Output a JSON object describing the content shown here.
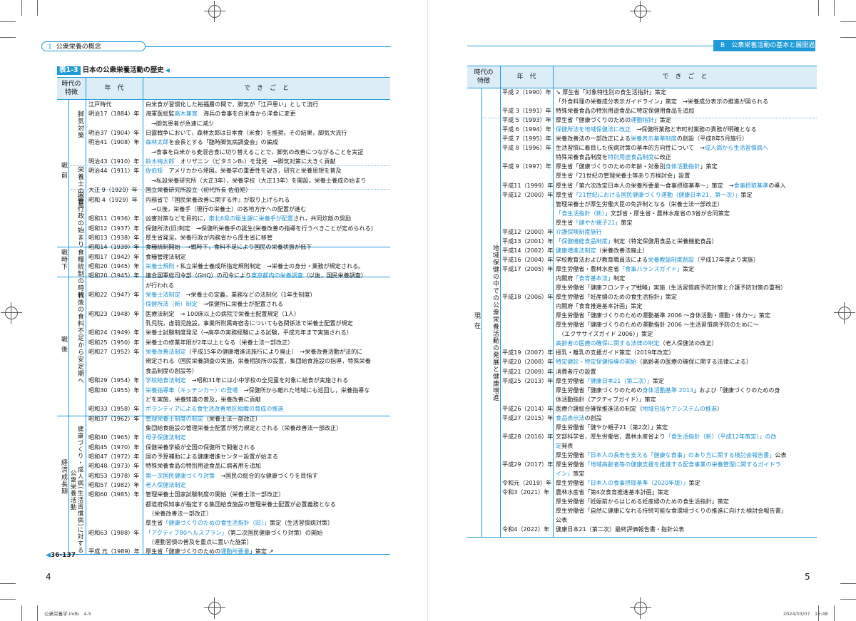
{
  "left_page": {
    "running_head": {
      "number": "1",
      "label": "公衆栄養の概念"
    },
    "table_title": {
      "label": "表1-3",
      "text": "日本の公衆栄養活動の歴史",
      "marker": "◀"
    },
    "columns": {
      "feature_l1": "時代の",
      "feature_l2": "特徴",
      "year": "年　代",
      "event": "で　き　ご　と"
    },
    "eras": {
      "prewar": "戦 前",
      "prewar_a": "脚気対策",
      "prewar_b": "栄養士の誕生",
      "prewar_c": "栄養行政の始まり",
      "wartime": "戦時下",
      "wartime_sub": "食糧統制の時代",
      "postwar": "戦 後",
      "postwar_sub": "戦後の食料不足から安定期へ",
      "growth": "経済成長期",
      "growth_sub": "健康づくり・成人病(生活習慣病)に対する公衆栄養活動"
    },
    "rows": [
      {
        "year": "江戸時代",
        "event": [
          {
            "t": "白米食が習慣化した裕福層の間で，脚気が「江戸患い」として流行"
          }
        ]
      },
      {
        "year": "明治17（1884）年",
        "event": [
          {
            "t": "海軍医総監"
          },
          {
            "t": "高木兼寛",
            "h": true
          },
          {
            "t": "　海兵の食事を白米食から洋食に変更"
          }
        ]
      },
      {
        "year": "",
        "event": [
          {
            "t": "　→脚気患者が急速に減少"
          }
        ]
      },
      {
        "year": "明治37（1904）年",
        "event": [
          {
            "t": "日露戦争において，森林太郎は日本食（米食）を推奨。その結果，脚気大流行"
          }
        ]
      },
      {
        "year": "明治41（1908）年",
        "event": [
          {
            "t": "森林太郎",
            "h": true
          },
          {
            "t": "を会長とする「臨時脚気病調査会」の編成"
          }
        ]
      },
      {
        "year": "",
        "event": [
          {
            "t": "　→食事を白米から麦混合食に切り替えることで，脚気の改善につながることを実証"
          }
        ]
      },
      {
        "year": "明治43（1910）年",
        "event": [
          {
            "t": "鈴木梅太郎",
            "h": true
          },
          {
            "t": "　オリザニン（ビタミンB₁）を発見　→脚気対策に大きく貢献"
          }
        ]
      },
      {
        "year": "明治44（1911）年",
        "event": [
          {
            "t": "佐伯矩",
            "h": true
          },
          {
            "t": "　アメリカから帰国。栄養学の重要性を説き，研究と栄養思想を普及"
          }
        ]
      },
      {
        "year": "",
        "event": [
          {
            "t": "　→私設栄養研究所（大正3年），栄養学校（大正13年）を開設。栄養士養成の始まり"
          }
        ]
      },
      {
        "year": "大正 9（1920）年",
        "event": [
          {
            "t": "国立栄養研究所設立（初代所長 佐伯矩）"
          }
        ]
      },
      {
        "year": "昭和 4（1929）年",
        "event": [
          {
            "t": "内務省で『国民栄養改善に関する件』が取り上げられる"
          }
        ]
      },
      {
        "year": "",
        "event": [
          {
            "t": "　→以後，栄養手（現行の栄養士）の各地方庁への配置が進む"
          }
        ]
      },
      {
        "year": "昭和11（1936）年",
        "event": [
          {
            "t": "凶害対策などを目的に，"
          },
          {
            "t": "東北6県の衛生課に栄養手が配置",
            "h": true
          },
          {
            "t": "され，共同炊飯の奨励"
          }
        ]
      },
      {
        "year": "昭和12（1937）年",
        "event": [
          {
            "t": "保健所法(旧)制定　→保健所栄養手の誕生(栄養改善の指導を行うべきことが定められる)"
          }
        ]
      },
      {
        "year": "昭和13（1938）年",
        "event": [
          {
            "t": "厚生省発足。栄養行政が内務省から厚生省に移管"
          }
        ]
      },
      {
        "year": "昭和14（1939）年",
        "event": [
          {
            "t": "食糧統制開始　→戦時下，食料不足により国民の栄養状態が低下"
          }
        ]
      },
      {
        "year": "昭和17（1942）年",
        "event": [
          {
            "t": "食糧管理法制定"
          }
        ]
      },
      {
        "year": "昭和20（1945）年",
        "event": [
          {
            "t": "栄養士規則",
            "h": true
          },
          {
            "t": "・私立栄養士養成所指定規則制定　→栄養士の身分・業務が規定される。"
          }
        ]
      },
      {
        "year": "昭和20（1945）年",
        "event": [
          {
            "t": "連合国軍総司令部（GHQ）の司令により"
          },
          {
            "t": "東京都内の栄養調査",
            "h": true
          },
          {
            "t": "（以後，国民栄養調査）"
          }
        ]
      },
      {
        "year": "",
        "event": [
          {
            "t": "が行われる"
          }
        ]
      },
      {
        "year": "昭和22（1947）年",
        "event": [
          {
            "t": "栄養士法制定",
            "h": true
          },
          {
            "t": "　→栄養士の定義，業務などの法制化（1年生制度）"
          }
        ]
      },
      {
        "year": "",
        "event": [
          {
            "t": "保健所法（新）制定",
            "h": true
          },
          {
            "t": "　→保健所に栄養士が配置される"
          }
        ]
      },
      {
        "year": "昭和23（1948）年",
        "event": [
          {
            "t": "医療法制定　→ 100床以上の病院で栄養士配置規定（1人）"
          }
        ]
      },
      {
        "year": "",
        "event": [
          {
            "t": "乳児院，虚弱児施設，事業所附属寄宿舎についても各関係法で栄養士配置が規定"
          }
        ]
      },
      {
        "year": "昭和24（1949）年",
        "event": [
          {
            "t": "栄養士試験制度発足（→高卒の実務経験による試験，平成元年まで実施される）"
          }
        ]
      },
      {
        "year": "昭和25（1950）年",
        "event": [
          {
            "t": "栄養士の修業年限が2年以上となる（栄養士法一部改正）"
          }
        ]
      },
      {
        "year": "昭和27（1952）年",
        "event": [
          {
            "t": "栄養改善法制定",
            "h": true
          },
          {
            "t": "（平成15年の健康増進法施行により廃止）　→栄養改善活動が法的に"
          }
        ]
      },
      {
        "year": "",
        "event": [
          {
            "t": "規定される（国民栄養調査の実施，栄養相談所の設置，集団給食施設の指導，特殊栄養"
          }
        ]
      },
      {
        "year": "",
        "event": [
          {
            "t": "食品制度の創設等）"
          }
        ]
      },
      {
        "year": "昭和29（1954）年",
        "event": [
          {
            "t": "学校給食法制定",
            "h": true
          },
          {
            "t": "　→昭和31年には小中学校の全児童を対象に給食が実施される"
          }
        ]
      },
      {
        "year": "昭和30（1955）年",
        "event": [
          {
            "t": "栄養指導車（キッチンカー）の登場",
            "h": true
          },
          {
            "t": "　→保健所から離れた地域にも巡回し，栄養指導な"
          }
        ]
      },
      {
        "year": "",
        "event": [
          {
            "t": "どを実施，栄養知識の普及，栄養改善に貢献"
          }
        ]
      },
      {
        "year": "昭和33（1958）年",
        "event": [
          {
            "t": "ボランティアによる食生活改善地区組織の育成の推進",
            "h": true
          }
        ]
      },
      {
        "year": "昭和37（1962）年",
        "event": [
          {
            "t": "管理栄養士制度の制定",
            "h": true
          },
          {
            "t": "（栄養士法一部改正）"
          }
        ]
      },
      {
        "year": "",
        "event": [
          {
            "t": "集団給食施設の管理栄養士配置が努力規定とされる（栄養改善法一部改正）"
          }
        ]
      },
      {
        "year": "昭和40（1965）年",
        "event": [
          {
            "t": "母子保健法制定",
            "h": true
          }
        ]
      },
      {
        "year": "昭和45（1970）年",
        "event": [
          {
            "t": "保健栄養学級が全国の保健所で開催される"
          }
        ]
      },
      {
        "year": "昭和47（1972）年",
        "event": [
          {
            "t": "国の予算補助による健康増進センター設置が始まる"
          }
        ]
      },
      {
        "year": "昭和48（1973）年",
        "event": [
          {
            "t": "特殊栄養食品の特別用途食品に病者用を追加"
          }
        ]
      },
      {
        "year": "昭和53（1978）年",
        "event": [
          {
            "t": "第一次国民健康づくり対策",
            "h": true
          },
          {
            "t": "　→国民の総合的な健康づくりを目指す"
          }
        ]
      },
      {
        "year": "昭和57（1982）年",
        "event": [
          {
            "t": "老人保健法制定",
            "h": true
          }
        ]
      },
      {
        "year": "昭和60（1985）年",
        "event": [
          {
            "t": "管理栄養士国家試験制度の開始（栄養士法一部改正）"
          }
        ]
      },
      {
        "year": "",
        "event": [
          {
            "t": "都道府県知事が指定する集団給食施設の管理栄養士配置が必置義務となる"
          }
        ]
      },
      {
        "year": "",
        "event": [
          {
            "t": "　（栄養改善法一部改正）"
          }
        ]
      },
      {
        "year": "",
        "event": [
          {
            "t": "厚生省"
          },
          {
            "t": "「健康づくりのための食生活指針（旧）」",
            "h": true
          },
          {
            "t": "策定（生活習慣病対策）"
          }
        ]
      },
      {
        "year": "昭和63（1988）年",
        "event": [
          {
            "t": "「アクティブ80ヘルスプラン」",
            "h": true
          },
          {
            "t": "（第二次国民健康づくり対策）の開始"
          }
        ]
      },
      {
        "year": "",
        "event": [
          {
            "t": "　（運動習慣の普及を重点に置いた施策）"
          }
        ]
      },
      {
        "year": "平成 元（1989）年",
        "event": [
          {
            "t": "厚生省「健康づくりのための"
          },
          {
            "t": "運動所要量",
            "h": true
          },
          {
            "t": "」策定 ↗"
          }
        ]
      }
    ],
    "xref": "36-137",
    "page_number": "4",
    "footer_file": "公衆栄養学.indb　4-5"
  },
  "right_page": {
    "running_head": {
      "letter": "B",
      "label": "公衆栄養活動の基本と展開過程"
    },
    "columns": {
      "feature_l1": "時代の",
      "feature_l2": "特徴",
      "year": "年　代",
      "event": "で　き　ご　と"
    },
    "eras": {
      "present": "現 在",
      "present_sub": "地域保健の中での公衆栄養活動の発展と健康増進"
    },
    "rows": [
      {
        "year": "平成 2（1990）年",
        "event": [
          {
            "t": "↘ 厚生省「対象特性別の食生活指針」策定"
          }
        ]
      },
      {
        "year": "",
        "event": [
          {
            "t": "「外食料理の栄養成分表示ガイドライン」策定　→栄養成分表示の推進が図られる"
          }
        ]
      },
      {
        "year": "平成 3（1991）年",
        "event": [
          {
            "t": "特殊栄養食品の特別用途食品に特定保健用食品を追加"
          }
        ]
      },
      {
        "year": "平成 5（1993）年",
        "event": [
          {
            "t": "厚生省「健康づくりのための"
          },
          {
            "t": "運動指針",
            "h": true
          },
          {
            "t": "」策定"
          }
        ]
      },
      {
        "year": "平成 6（1994）年",
        "event": [
          {
            "t": "保健所法を地域保健法に改正",
            "h": true
          },
          {
            "t": "　→保健所業務と市町村業務の責務が明確となる"
          }
        ]
      },
      {
        "year": "平成 7（1995）年",
        "event": [
          {
            "t": "栄養改善法の一部改正による"
          },
          {
            "t": "栄養表示基準制度",
            "h": true
          },
          {
            "t": "の創設（平成8年5月施行）"
          }
        ]
      },
      {
        "year": "平成 8（1996）年",
        "event": [
          {
            "t": "生活習慣に着目した疾病対策の基本的方向性について　→"
          },
          {
            "t": "成人病から生活習慣病へ",
            "h": true
          }
        ]
      },
      {
        "year": "",
        "event": [
          {
            "t": "特殊栄養食品制度を"
          },
          {
            "t": "特別用途食品制度",
            "h": true
          },
          {
            "t": "に改正"
          }
        ]
      },
      {
        "year": "平成 9（1997）年",
        "event": [
          {
            "t": "厚生省「健康づくりのための年齢・対象別"
          },
          {
            "t": "身体活動指針",
            "h": true
          },
          {
            "t": "」策定"
          }
        ]
      },
      {
        "year": "",
        "event": [
          {
            "t": "厚生省「21世紀の管理栄養士等あり方検討会」設置"
          }
        ]
      },
      {
        "year": "平成11（1999）年",
        "event": [
          {
            "t": "厚生省「第六次改定日本人の栄養所要量〜食事摂取基準〜」策定　→"
          },
          {
            "t": "食事摂取基準",
            "h": true
          },
          {
            "t": "の導入"
          }
        ]
      },
      {
        "year": "平成12（2000）年",
        "event": [
          {
            "t": "厚生省"
          },
          {
            "t": "「21世紀における国民健康づくり運動（健康日本21，第一次）」",
            "h": true
          },
          {
            "t": "策定"
          }
        ]
      },
      {
        "year": "",
        "event": [
          {
            "t": "管理栄養士が厚生労働大臣の免許制となる（栄養士法一部改正）"
          }
        ]
      },
      {
        "year": "",
        "event": [
          {
            "t": "「食生活指針（新）」",
            "h": true
          },
          {
            "t": "文部省・厚生省・農林水産省の3省が合同策定"
          }
        ]
      },
      {
        "year": "",
        "event": [
          {
            "t": "厚生省"
          },
          {
            "t": "「健やか親子21」",
            "h": true
          },
          {
            "t": "策定"
          }
        ]
      },
      {
        "year": "平成12（2000）年",
        "event": [
          {
            "t": "介護保険制度施行",
            "h": true
          }
        ]
      },
      {
        "year": "平成13（2001）年",
        "event": [
          {
            "t": "「保健機能食品制度」",
            "h": true
          },
          {
            "t": "制定（特定保健用食品と栄養機能食品）"
          }
        ]
      },
      {
        "year": "平成14（2002）年",
        "event": [
          {
            "t": "健康増進法制定",
            "h": true
          },
          {
            "t": "（栄養改善法廃止）"
          }
        ]
      },
      {
        "year": "平成16（2004）年",
        "event": [
          {
            "t": "学校教育法および教育職員法による"
          },
          {
            "t": "栄養教諭制度創設",
            "h": true
          },
          {
            "t": "（平成17年度より実施）"
          }
        ]
      },
      {
        "year": "平成17（2005）年",
        "event": [
          {
            "t": "厚生労働省・農林水産省"
          },
          {
            "t": "「食事バランスガイド」",
            "h": true
          },
          {
            "t": "策定"
          }
        ]
      },
      {
        "year": "",
        "event": [
          {
            "t": "内閣府"
          },
          {
            "t": "「食育基本法」",
            "h": true
          },
          {
            "t": "制定"
          }
        ]
      },
      {
        "year": "",
        "event": [
          {
            "t": "厚生労働省「健康フロンティア戦略」実施（生活習慣病予防対策と介護予防対策の重視）"
          }
        ]
      },
      {
        "year": "平成18（2006）年",
        "event": [
          {
            "t": "厚生労働省「妊産婦のための食生活指針」策定"
          }
        ]
      },
      {
        "year": "",
        "event": [
          {
            "t": "内閣府「食育推進基本計画」策定"
          }
        ]
      },
      {
        "year": "",
        "event": [
          {
            "t": "厚生労働省「健康づくりのための運動基準 2006 〜身体活動・運動・体力〜」策定"
          }
        ]
      },
      {
        "year": "",
        "event": [
          {
            "t": "厚生労働省「健康づくりのための運動指針 2006 〜生活習慣病予防のために〜"
          }
        ]
      },
      {
        "year": "",
        "event": [
          {
            "t": "　〈エクササイズガイド 2006〉」策定"
          }
        ]
      },
      {
        "year": "",
        "event": [
          {
            "t": "高齢者の医療の確保に関する法律の制定",
            "h": true
          },
          {
            "t": "（老人保健法の改正）"
          }
        ]
      },
      {
        "year": "平成19（2007）年",
        "event": [
          {
            "t": "授乳・離乳の支援ガイド策定（2019年改定）"
          }
        ]
      },
      {
        "year": "平成20（2008）年",
        "event": [
          {
            "t": "特定健診・特定保健指導の開始",
            "h": true
          },
          {
            "t": "（高齢者の医療の確保に関する法律による）"
          }
        ]
      },
      {
        "year": "平成21（2009）年",
        "event": [
          {
            "t": "消費者庁の設置"
          }
        ]
      },
      {
        "year": "平成25（2013）年",
        "event": [
          {
            "t": "厚生労働省"
          },
          {
            "t": "「健康日本21（第二次）」",
            "h": true
          },
          {
            "t": "策定"
          }
        ]
      },
      {
        "year": "",
        "event": [
          {
            "t": "厚生労働省「健康づくりのための"
          },
          {
            "t": "身体活動基準 2013",
            "h": true
          },
          {
            "t": "」および「健康づくりのための身"
          }
        ]
      },
      {
        "year": "",
        "event": [
          {
            "t": "体活動指針（アクティブガイド）」策定"
          }
        ]
      },
      {
        "year": "平成26（2014）年",
        "event": [
          {
            "t": "医療介護総合確保推進法の制定（"
          },
          {
            "t": "地域包括ケアシステムの推進",
            "h": true
          },
          {
            "t": "）"
          }
        ]
      },
      {
        "year": "平成27（2015）年",
        "event": [
          {
            "t": "食品表示法",
            "h": true
          },
          {
            "t": "の創設"
          }
        ]
      },
      {
        "year": "",
        "event": [
          {
            "t": "厚生労働省「健やか親子21（第2次）」策定"
          }
        ]
      },
      {
        "year": "平成28（2016）年",
        "event": [
          {
            "t": "文部科学省，厚生労働省，農林水産省より"
          },
          {
            "t": "「食生活指針（新）（平成12年策定）」の改",
            "h": true
          }
        ]
      },
      {
        "year": "",
        "event": [
          {
            "t": "定",
            "h": true
          },
          {
            "t": "発表"
          }
        ]
      },
      {
        "year": "",
        "event": [
          {
            "t": "厚生労働省"
          },
          {
            "t": "「日本人の長寿を支える「健康な食事」のあり方に関する検討会報告書」",
            "h": true
          },
          {
            "t": "公表"
          }
        ]
      },
      {
        "year": "平成29（2017）年",
        "event": [
          {
            "t": "厚生労働省"
          },
          {
            "t": "「地域高齢者等の健康支援を推進する配食事業の栄養管理に関するガイドラ",
            "h": true
          }
        ]
      },
      {
        "year": "",
        "event": [
          {
            "t": "イン」",
            "h": true
          },
          {
            "t": "策定"
          }
        ]
      },
      {
        "year": "令和元（2019）年",
        "event": [
          {
            "t": "厚生労働省"
          },
          {
            "t": "「日本人の食事摂取基準（2020年版）」",
            "h": true
          },
          {
            "t": "策定"
          }
        ]
      },
      {
        "year": "令和3（2021）年",
        "event": [
          {
            "t": "農林水産省「第4次食育推進基本計画」策定"
          }
        ]
      },
      {
        "year": "",
        "event": [
          {
            "t": "厚生労働省「妊娠前からはじめる妊産婦のための食生活指針」策定"
          }
        ]
      },
      {
        "year": "",
        "event": [
          {
            "t": "厚生労働省「自然に健康になれる持続可能な食環境づくりの推進に向けた検討会報告書」"
          }
        ]
      },
      {
        "year": "",
        "event": [
          {
            "t": "公表"
          }
        ]
      },
      {
        "year": "令和4（2022）年",
        "event": [
          {
            "t": "健康日本21（第二次）最終評価報告書・指針公表"
          }
        ]
      }
    ],
    "page_number": "5",
    "footer_date": "2024/03/07　15:48"
  }
}
